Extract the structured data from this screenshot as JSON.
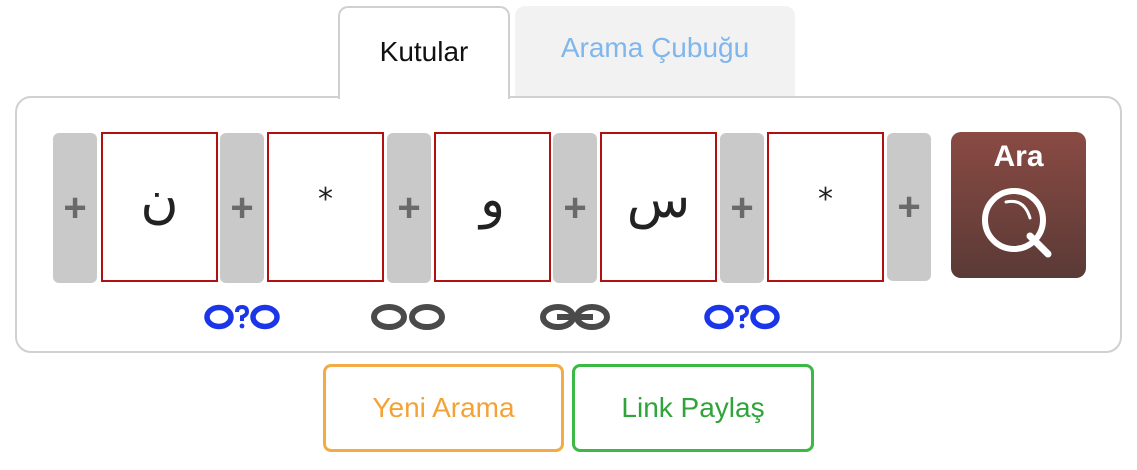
{
  "tabs": {
    "active": "Kutular",
    "inactive": "Arama Çubuğu"
  },
  "search_boxes": [
    {
      "value": "ن"
    },
    {
      "value": "*"
    },
    {
      "value": "و"
    },
    {
      "value": "س"
    },
    {
      "value": "*"
    }
  ],
  "add_button_label": "+",
  "search_button": {
    "label": "Ara"
  },
  "link_icons": [
    "optional-link-icon",
    "unlinked-icon",
    "linked-icon",
    "optional-link-icon"
  ],
  "actions": {
    "new_search": "Yeni Arama",
    "share_link": "Link Paylaş"
  },
  "colors": {
    "box_border": "#b01010",
    "optional_link": "#1a36e8",
    "link_gray": "#4a4a4a",
    "search_button": "#7a4640",
    "new_search": "#f3ac44",
    "share_link": "#3cb844",
    "inactive_tab_text": "#7fb6ec"
  }
}
